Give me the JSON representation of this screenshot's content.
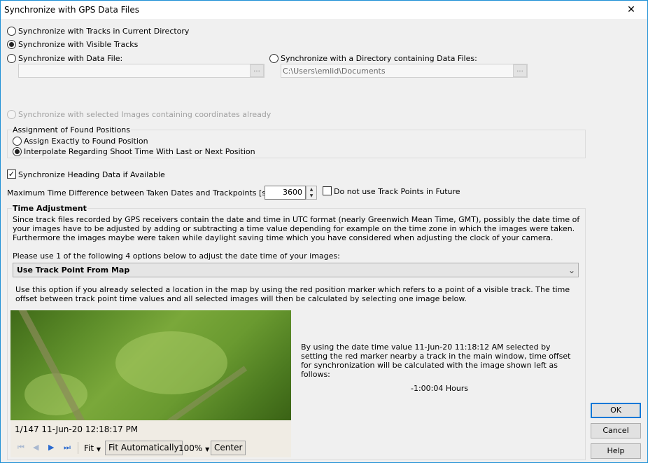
{
  "window": {
    "title": "Synchronize with GPS Data Files",
    "close_glyph": "✕"
  },
  "sync_options": {
    "tracks_current_dir": "Synchronize with Tracks in Current Directory",
    "visible_tracks": "Synchronize with Visible Tracks",
    "data_file": "Synchronize with Data File:",
    "directory": "Synchronize with a Directory containing Data Files:",
    "selected_images": "Synchronize with selected Images containing coordinates already",
    "selected": "visible_tracks"
  },
  "data_file_field": {
    "value": "",
    "browse_label": "..."
  },
  "directory_field": {
    "value": "C:\\Users\\emlid\\Documents",
    "browse_label": "..."
  },
  "assignment": {
    "group_title": "Assignment of Found Positions",
    "exact": "Assign Exactly to Found Position",
    "interpolate": "Interpolate Regarding Shoot Time With Last or Next Position",
    "selected": "interpolate"
  },
  "heading": {
    "label": "Synchronize Heading Data if Available",
    "checked": true
  },
  "max_time": {
    "label": "Maximum Time Difference between Taken Dates and Trackpoints [seconds]:",
    "value": "3600",
    "future_label": "Do not use Track Points in Future",
    "future_checked": false
  },
  "time_adjustment": {
    "title": "Time Adjustment",
    "description": "Since track files recorded by GPS receivers contain the date and time in UTC format (nearly Greenwich Mean Time, GMT), possibly the date time of your images have to be adjusted by adding or subtracting a time value depending for example on the time zone in which the images were taken. Furthermore the images maybe were taken while daylight saving time which you have considered when adjusting the clock of your camera.",
    "options_prompt": "Please use 1 of the following 4 options below to adjust the date time of your images:",
    "selected_option": "Use Track Point From Map",
    "option_description": "Use this option if you already selected a location in the map by using the red position marker which refers to a point of a visible track. The time offset between track point time values and all selected images will then be calculated by selecting one image below.",
    "calc_text": "By using the date time value 11-Jun-20 11:18:12 AM selected by setting the red marker nearby a track in the main window, time offset for synchronization will be calculated with the image shown left as follows:",
    "offset": "-1:00:04 Hours"
  },
  "image_viewer": {
    "caption": "1/147 11-Jun-20 12:18:17 PM",
    "fit_label": "Fit",
    "fit_auto_label": "Fit Automatically",
    "zoom_label": "100%",
    "center_label": "Center"
  },
  "buttons": {
    "ok": "OK",
    "cancel": "Cancel",
    "help": "Help"
  }
}
